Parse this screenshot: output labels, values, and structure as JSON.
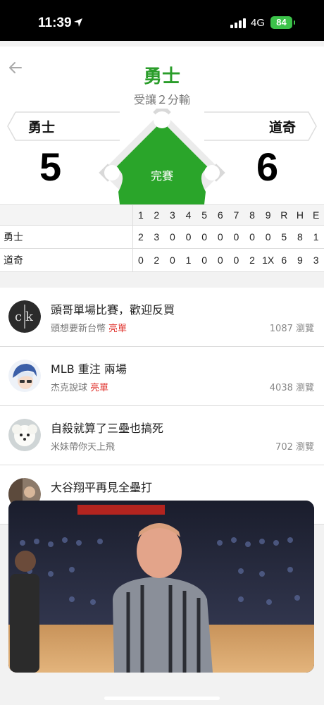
{
  "status_bar": {
    "time": "11:39",
    "network": "4G",
    "battery": "84"
  },
  "game": {
    "favored_team": "勇士",
    "spread_text": "受讓２分輸",
    "away_team": "勇士",
    "home_team": "道奇",
    "away_score": "5",
    "home_score": "6",
    "status": "完賽",
    "accent_color": "#2aa52a"
  },
  "line_score": {
    "headers": [
      "",
      "1",
      "2",
      "3",
      "4",
      "5",
      "6",
      "7",
      "8",
      "9",
      "R",
      "H",
      "E"
    ],
    "rows": [
      {
        "team": "勇士",
        "innings": [
          "2",
          "3",
          "0",
          "0",
          "0",
          "0",
          "0",
          "0",
          "0"
        ],
        "r": "5",
        "h": "8",
        "e": "1"
      },
      {
        "team": "道奇",
        "innings": [
          "0",
          "2",
          "0",
          "1",
          "0",
          "0",
          "0",
          "2",
          "1X"
        ],
        "r": "6",
        "h": "9",
        "e": "3"
      }
    ]
  },
  "posts": [
    {
      "title": "頭哥單場比賽，歡迎反買",
      "author": "頭想要新台幣",
      "tag": "亮單",
      "views": "1087 瀏覽",
      "avatar": "ck-logo"
    },
    {
      "title": "MLB 重注 兩場",
      "author": "杰克說球",
      "tag": "亮單",
      "views": "4038 瀏覽",
      "avatar": "anime-girl"
    },
    {
      "title": "自殺就算了三壘也搞死",
      "author": "米妹帶你天上飛",
      "tag": "",
      "views": "702 瀏覽",
      "avatar": "white-dog"
    },
    {
      "title": "大谷翔平再見全壘打",
      "author": "",
      "tag": "",
      "views": "",
      "avatar": "photo"
    }
  ],
  "video": {
    "label": "picture-in-picture-video"
  }
}
